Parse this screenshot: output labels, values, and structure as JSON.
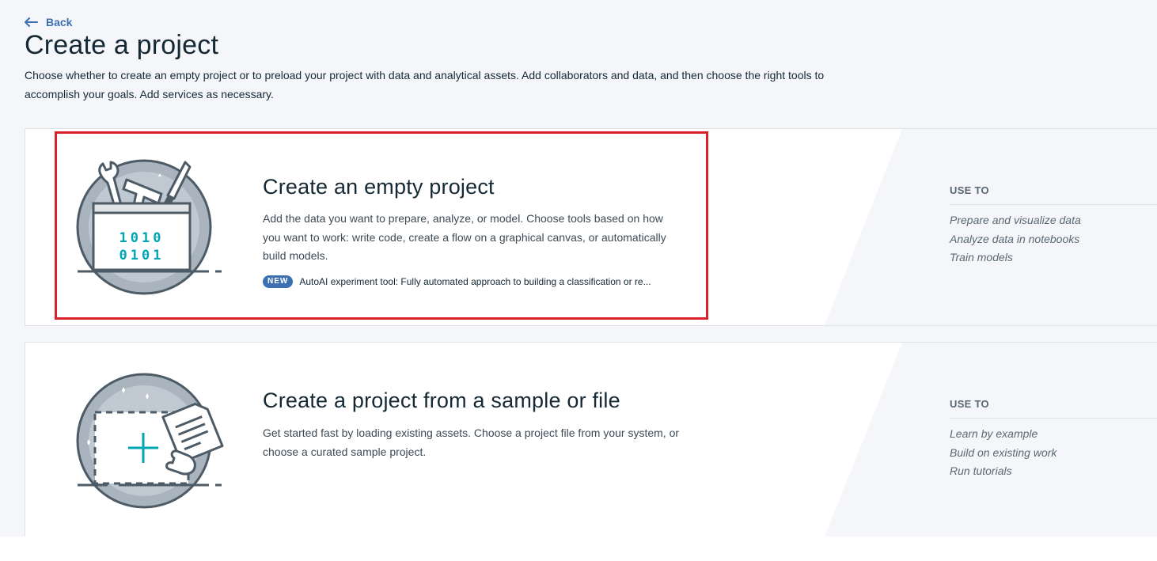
{
  "header": {
    "back_label": "Back",
    "title": "Create a project",
    "description": "Choose whether to create an empty project or to preload your project with data and analytical assets. Add collaborators and data, and then choose the right tools to accomplish your goals. Add services as necessary."
  },
  "cards": [
    {
      "title": "Create an empty project",
      "description": "Add the data you want to prepare, analyze, or model. Choose tools based on how you want to work: write code, create a flow on a graphical canvas, or automatically build models.",
      "badge": "NEW",
      "badge_text": "AutoAI experiment tool: Fully automated approach to building a classification or re...",
      "use_label": "USE TO",
      "uses": [
        "Prepare and visualize data",
        "Analyze data in notebooks",
        "Train models"
      ],
      "illustration": {
        "binary_line1": "1010",
        "binary_line2": "0101"
      }
    },
    {
      "title": "Create a project from a sample or file",
      "description": "Get started fast by loading existing assets. Choose a project file from your system, or choose a curated sample project.",
      "use_label": "USE TO",
      "uses": [
        "Learn by example",
        "Build on existing work",
        "Run tutorials"
      ]
    }
  ],
  "colors": {
    "accent": "#3d70b2",
    "highlight": "#d9202a",
    "teal": "#00a6b4"
  },
  "icons": [
    "arrow-left-icon",
    "toolbox-illustration",
    "sample-file-illustration"
  ]
}
